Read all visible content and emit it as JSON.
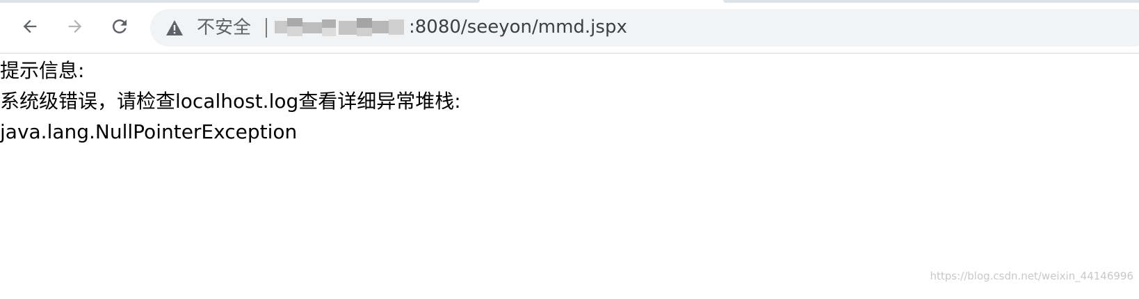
{
  "browser": {
    "security_label": "不安全",
    "url_visible_part": ":8080/seeyon/mmd.jspx",
    "icons": {
      "back": "arrow-left-icon",
      "forward": "arrow-right-icon",
      "reload": "reload-icon",
      "security": "warning-triangle-icon"
    },
    "colors": {
      "omnibox_bg": "#f1f3f4",
      "icon_active": "#5f6368",
      "icon_disabled": "#b4b4b4"
    }
  },
  "page": {
    "lines": [
      "提示信息:",
      "系统级错误，请检查localhost.log查看详细异常堆栈:",
      "java.lang.NullPointerException"
    ]
  },
  "watermark": "https://blog.csdn.net/weixin_44146996"
}
